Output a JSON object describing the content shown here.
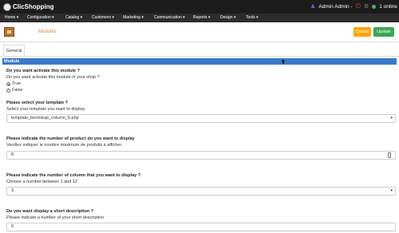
{
  "app": {
    "logo_text": "ClicShopping",
    "user_label": "Admin Admin -",
    "online_label": "1 online"
  },
  "nav": [
    {
      "label": "Home ▾"
    },
    {
      "label": "Configuration ▾"
    },
    {
      "label": "Catalog ▾"
    },
    {
      "label": "Customers ▾"
    },
    {
      "label": "Marketing ▾"
    },
    {
      "label": "Communication ▾"
    },
    {
      "label": "Reports ▾"
    },
    {
      "label": "Design ▾"
    },
    {
      "label": "Tools ▾"
    }
  ],
  "header": {
    "title": "Modules",
    "cancel_label": "Cancel",
    "update_label": "Update"
  },
  "tabs": [
    {
      "label": "General"
    }
  ],
  "section": {
    "title": "Module"
  },
  "fields": {
    "activate": {
      "question": "Do you want activate this module ?",
      "description": "Do you want activate this module in your shop ?",
      "options": [
        "True",
        "False"
      ],
      "selected": "True"
    },
    "template": {
      "question": "Please select your template ?",
      "description": "Select your template you want to display",
      "value": "template_bootstrap_column_5.php"
    },
    "products": {
      "question": "Please indicate the number of product do you want to display",
      "description": "Veuillez indiquer le nombre maximum de produits à afficher.",
      "value": "8"
    },
    "columns": {
      "question": "Please indicate the number of column that you want to display ?",
      "description": "Choose a number between 1 and 12",
      "value": "3"
    },
    "short_desc": {
      "question": "Do you want display a short description ?",
      "description": "Please indicate a number of your short description",
      "value": "0"
    }
  },
  "colors": {
    "accent": "#3a78c9",
    "cancel": "#f6a800",
    "update": "#3aa557",
    "title": "#e3843a"
  }
}
